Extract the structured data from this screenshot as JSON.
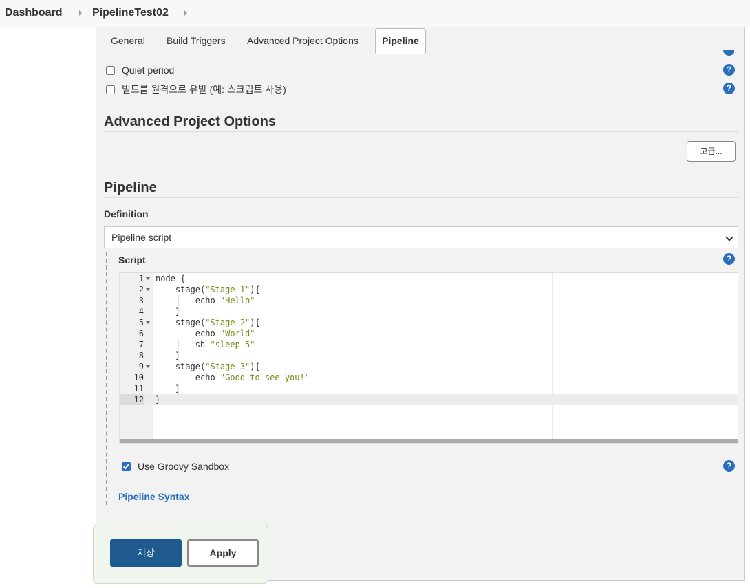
{
  "breadcrumb": {
    "items": [
      {
        "label": "Dashboard"
      },
      {
        "label": "PipelineTest02"
      }
    ]
  },
  "tabs": [
    {
      "label": "General"
    },
    {
      "label": "Build Triggers"
    },
    {
      "label": "Advanced Project Options"
    },
    {
      "label": "Pipeline",
      "active": true
    }
  ],
  "build_options": {
    "quiet_period": {
      "label": "Quiet period",
      "checked": false
    },
    "remote_trigger": {
      "label": "빌드를 원격으로 유발 (예: 스크립트 사용)",
      "checked": false
    }
  },
  "advanced_section": {
    "title": "Advanced Project Options",
    "advanced_button": "고급..."
  },
  "pipeline_section": {
    "title": "Pipeline",
    "definition_label": "Definition",
    "definition_value": "Pipeline script",
    "script_label": "Script",
    "script_lines": [
      {
        "n": "1",
        "text": "node {",
        "fold": true
      },
      {
        "n": "2",
        "text": "    stage(\"Stage 1\"){",
        "fold": true
      },
      {
        "n": "3",
        "text": "        echo \"Hello\"",
        "fold": false
      },
      {
        "n": "4",
        "text": "    }",
        "fold": false
      },
      {
        "n": "5",
        "text": "    stage(\"Stage 2\"){",
        "fold": true
      },
      {
        "n": "6",
        "text": "        echo \"World\"",
        "fold": false
      },
      {
        "n": "7",
        "text": "        sh \"sleep 5\"",
        "fold": false
      },
      {
        "n": "8",
        "text": "    }",
        "fold": false
      },
      {
        "n": "9",
        "text": "    stage(\"Stage 3\"){",
        "fold": true
      },
      {
        "n": "10",
        "text": "        echo \"Good to see you!\"",
        "fold": false
      },
      {
        "n": "11",
        "text": "    }",
        "fold": false
      },
      {
        "n": "12",
        "text": "}",
        "fold": false,
        "active": true
      }
    ],
    "groovy_sandbox": {
      "label": "Use Groovy Sandbox",
      "checked": true
    },
    "syntax_link": "Pipeline Syntax"
  },
  "help_glyph": "?",
  "buttons": {
    "save": "저장",
    "apply": "Apply"
  },
  "colors": {
    "accent": "#2a6ebb",
    "save_button": "#1f5a8f",
    "string_literal": "#6a8e12"
  }
}
